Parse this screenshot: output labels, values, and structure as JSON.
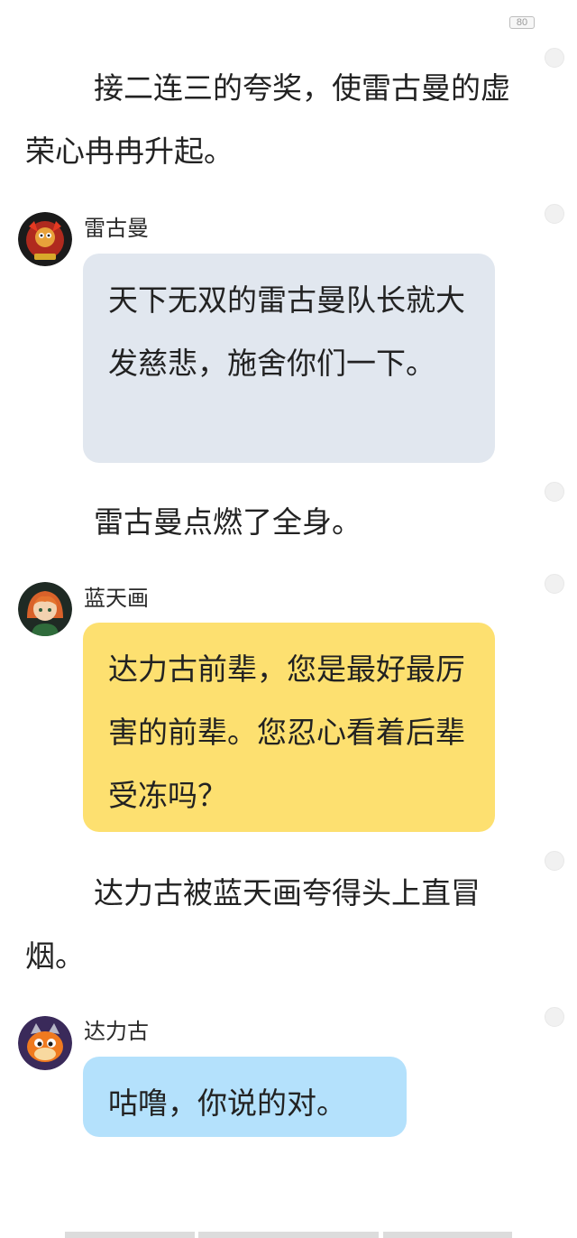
{
  "status": {
    "battery_label": "80"
  },
  "narration": [
    "接二连三的夸奖，使雷古曼的虚荣心冉冉升起。",
    "雷古曼点燃了全身。",
    "达力古被蓝天画夸得头上直冒烟。"
  ],
  "messages": [
    {
      "name": "雷古曼",
      "avatar": "red-dragon-avatar",
      "text": "天下无双的雷古曼队长就大发慈悲，施舍你们一下。",
      "color": "#e1e7ef"
    },
    {
      "name": "蓝天画",
      "avatar": "girl-avatar",
      "text": "达力古前辈，您是最好最厉害的前辈。您忍心看着后辈受冻吗？",
      "color": "#fde070"
    },
    {
      "name": "达力古",
      "avatar": "orange-dragon-avatar",
      "text": "咕噜，你说的对。",
      "color": "#b4e1fc"
    }
  ]
}
